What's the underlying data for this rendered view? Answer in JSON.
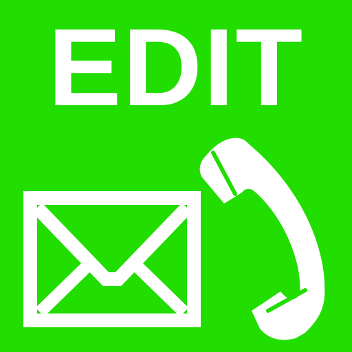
{
  "app": {
    "title": "EDIT"
  },
  "colors": {
    "background": "#22dd00",
    "foreground": "#ffffff"
  },
  "icons": {
    "mail": "envelope-icon",
    "phone": "phone-handset-icon"
  }
}
